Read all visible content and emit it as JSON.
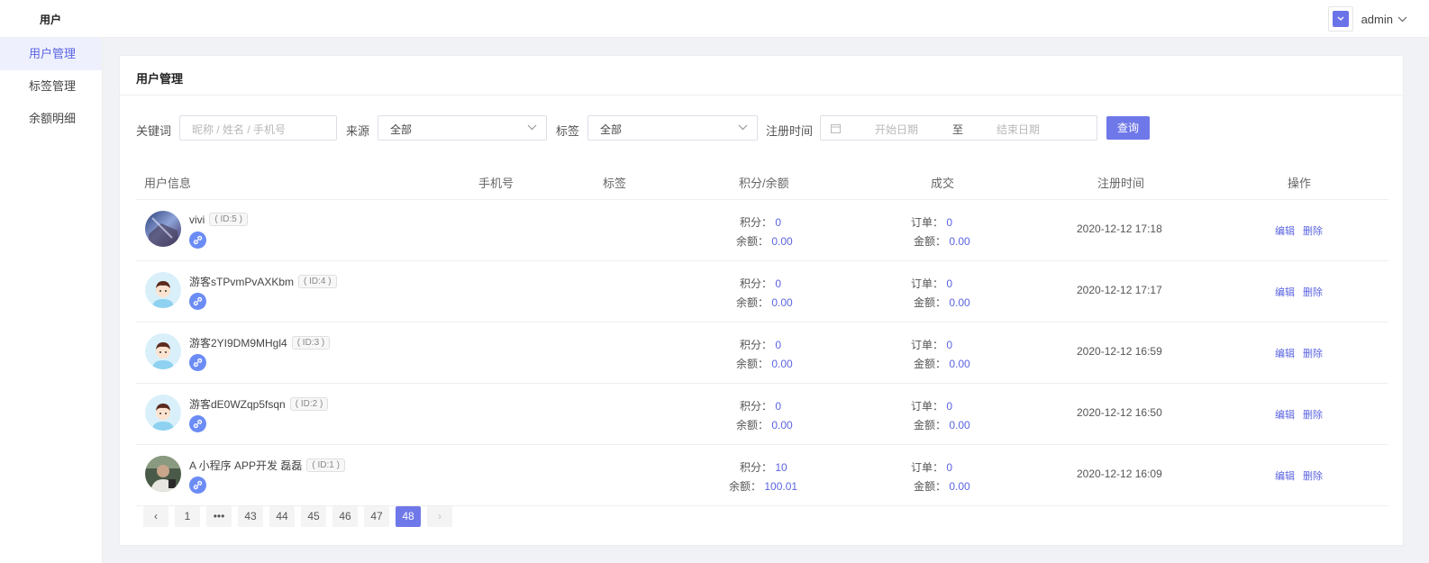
{
  "header": {
    "module": "用户",
    "username": "admin",
    "caret_icon": "chevron-down-icon"
  },
  "sidebar": {
    "items": [
      {
        "label": "用户管理",
        "active": true
      },
      {
        "label": "标签管理",
        "active": false
      },
      {
        "label": "余额明细",
        "active": false
      }
    ]
  },
  "card": {
    "title": "用户管理"
  },
  "filters": {
    "keyword_label": "关键词",
    "keyword_placeholder": "昵称 / 姓名 / 手机号",
    "source_label": "来源",
    "source_value": "全部",
    "tag_label": "标签",
    "tag_value": "全部",
    "regtime_label": "注册时间",
    "start_placeholder": "开始日期",
    "range_sep": "至",
    "end_placeholder": "结束日期",
    "query_button": "查询"
  },
  "table": {
    "columns": [
      "用户信息",
      "手机号",
      "标签",
      "积分/余额",
      "成交",
      "注册时间",
      "操作"
    ],
    "points_label": "积分：",
    "balance_label": "余额：",
    "order_label": "订单：",
    "amount_label": "金额：",
    "edit_label": "编辑",
    "delete_label": "删除",
    "rows": [
      {
        "name": "vivi",
        "id": "( ID:5 )",
        "points": "0",
        "balance": "0.00",
        "orders": "0",
        "amount": "0.00",
        "reg_time": "2020-12-12 17:18",
        "avatar": "landscape-photo"
      },
      {
        "name": "游客sTPvmPvAXKbm",
        "id": "( ID:4 )",
        "points": "0",
        "balance": "0.00",
        "orders": "0",
        "amount": "0.00",
        "reg_time": "2020-12-12 17:17",
        "avatar": "cartoon-boy"
      },
      {
        "name": "游客2YI9DM9MHgl4",
        "id": "( ID:3 )",
        "points": "0",
        "balance": "0.00",
        "orders": "0",
        "amount": "0.00",
        "reg_time": "2020-12-12 16:59",
        "avatar": "cartoon-boy"
      },
      {
        "name": "游客dE0WZqp5fsqn",
        "id": "( ID:2 )",
        "points": "0",
        "balance": "0.00",
        "orders": "0",
        "amount": "0.00",
        "reg_time": "2020-12-12 16:50",
        "avatar": "cartoon-boy"
      },
      {
        "name": "A 小程序 APP开发 磊磊",
        "id": "( ID:1 )",
        "points": "10",
        "balance": "100.01",
        "orders": "0",
        "amount": "0.00",
        "reg_time": "2020-12-12 16:09",
        "avatar": "person-photo"
      }
    ]
  },
  "pagination": {
    "prev": "‹",
    "pages": [
      "1",
      "•••",
      "43",
      "44",
      "45",
      "46",
      "47",
      "48"
    ],
    "current": "48",
    "next": "›"
  },
  "colors": {
    "accent": "#6f78e8",
    "link": "#5b64e0",
    "active_bg": "#eef0fd"
  }
}
